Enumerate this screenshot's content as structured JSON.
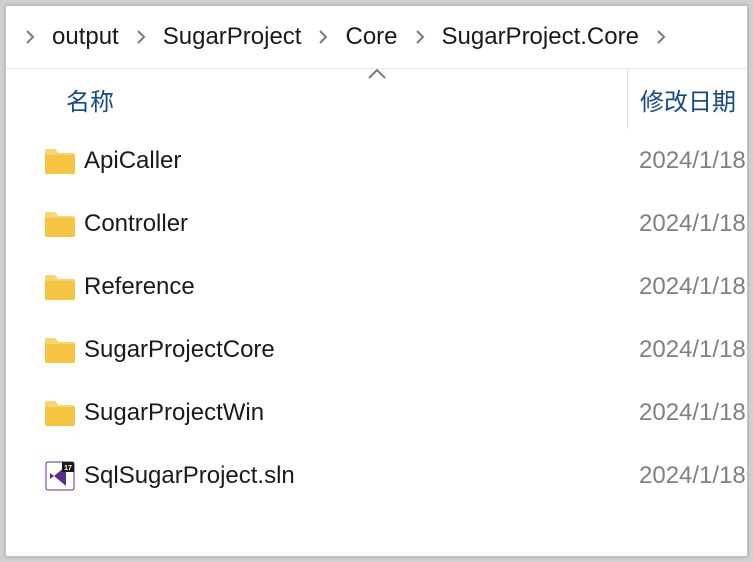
{
  "breadcrumbs": [
    {
      "label": "output"
    },
    {
      "label": "SugarProject"
    },
    {
      "label": "Core"
    },
    {
      "label": "SugarProject.Core"
    }
  ],
  "headers": {
    "name": "名称",
    "date": "修改日期"
  },
  "items": [
    {
      "type": "folder",
      "name": "ApiCaller",
      "date": "2024/1/18"
    },
    {
      "type": "folder",
      "name": "Controller",
      "date": "2024/1/18"
    },
    {
      "type": "folder",
      "name": "Reference",
      "date": "2024/1/18"
    },
    {
      "type": "folder",
      "name": "SugarProjectCore",
      "date": "2024/1/18"
    },
    {
      "type": "folder",
      "name": "SugarProjectWin",
      "date": "2024/1/18"
    },
    {
      "type": "sln",
      "name": "SqlSugarProject.sln",
      "date": "2024/1/18"
    }
  ]
}
